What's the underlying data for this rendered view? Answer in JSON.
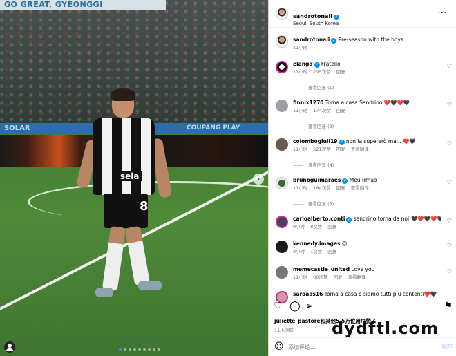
{
  "media": {
    "banner_text": "GO GREAT, GYEONGGI",
    "ad_board_left": "SOLAR",
    "ad_board_right": "COUPANG PLAY",
    "sponsor": "sela",
    "shirt_number": "8",
    "next_icon": "›",
    "carousel": {
      "count": 9,
      "active_index": 0
    }
  },
  "header": {
    "username": "sandrotonali",
    "location": "Seoul, South Korea",
    "more_icon": "···"
  },
  "caption": {
    "username": "sandrotonali",
    "text": "Pre-season with the boys.",
    "time": "11小时"
  },
  "comments": [
    {
      "username": "elanga",
      "verified": true,
      "text": "Fratello",
      "time": "11小时",
      "likes": "295次赞",
      "reply": "回复",
      "translate": "",
      "view_replies": "查看回复 (1)"
    },
    {
      "username": "finnix1270",
      "verified": false,
      "text": "Torna a casa Sandrino ❤️🖤❤️🖤",
      "time": "11小时",
      "likes": "174次赞",
      "reply": "回复",
      "translate": "",
      "view_replies": "查看回复 (3)"
    },
    {
      "username": "colombogiuli19",
      "verified": true,
      "text": "non la supererò mai.. ❤️🖤",
      "time": "11小时",
      "likes": "221次赞",
      "reply": "回复",
      "translate": "查看翻译",
      "view_replies": "查看回复 (4)"
    },
    {
      "username": "brunoguimaraes",
      "verified": true,
      "text": "Meu irmão",
      "time": "11小时",
      "likes": "184次赞",
      "reply": "回复",
      "translate": "查看翻译",
      "view_replies": "查看回复 (3)"
    },
    {
      "username": "carloalberto.conti",
      "verified": true,
      "text": "sandrino torna da noi!🖤❤️🖤❤️🖤",
      "time": "9小时",
      "likes": "8次赞",
      "reply": "回复",
      "translate": "",
      "view_replies": ""
    },
    {
      "username": "kennedy.images",
      "verified": false,
      "text": "😍",
      "time": "8小时",
      "likes": "1次赞",
      "reply": "回复",
      "translate": "",
      "view_replies": ""
    },
    {
      "username": "memecastle_united",
      "verified": false,
      "text": "Love you",
      "time": "11小时",
      "likes": "80次赞",
      "reply": "回复",
      "translate": "查看翻译",
      "view_replies": ""
    },
    {
      "username": "saraaas16",
      "verified": false,
      "text": "Torna a casa e siamo tutti più contenti❤️🖤",
      "time": "",
      "likes": "",
      "reply": "",
      "translate": "",
      "view_replies": ""
    }
  ],
  "heart_icon": "♡",
  "actions": {
    "like_icon": "♡",
    "comment_icon": "◯",
    "share_icon": "➢",
    "save_icon": "⚑"
  },
  "likes_line": {
    "user": "juliette_pastore",
    "suffix": "和其他5.5万位用户赞了"
  },
  "post_time": "11小时前",
  "comment_box": {
    "placeholder": "添加评论...",
    "post_label": "发布"
  },
  "watermark": "dydftl.com",
  "colors": {
    "accent": "#0095f6",
    "verified": "#0095f6",
    "post_disabled": "#b3dbff"
  }
}
